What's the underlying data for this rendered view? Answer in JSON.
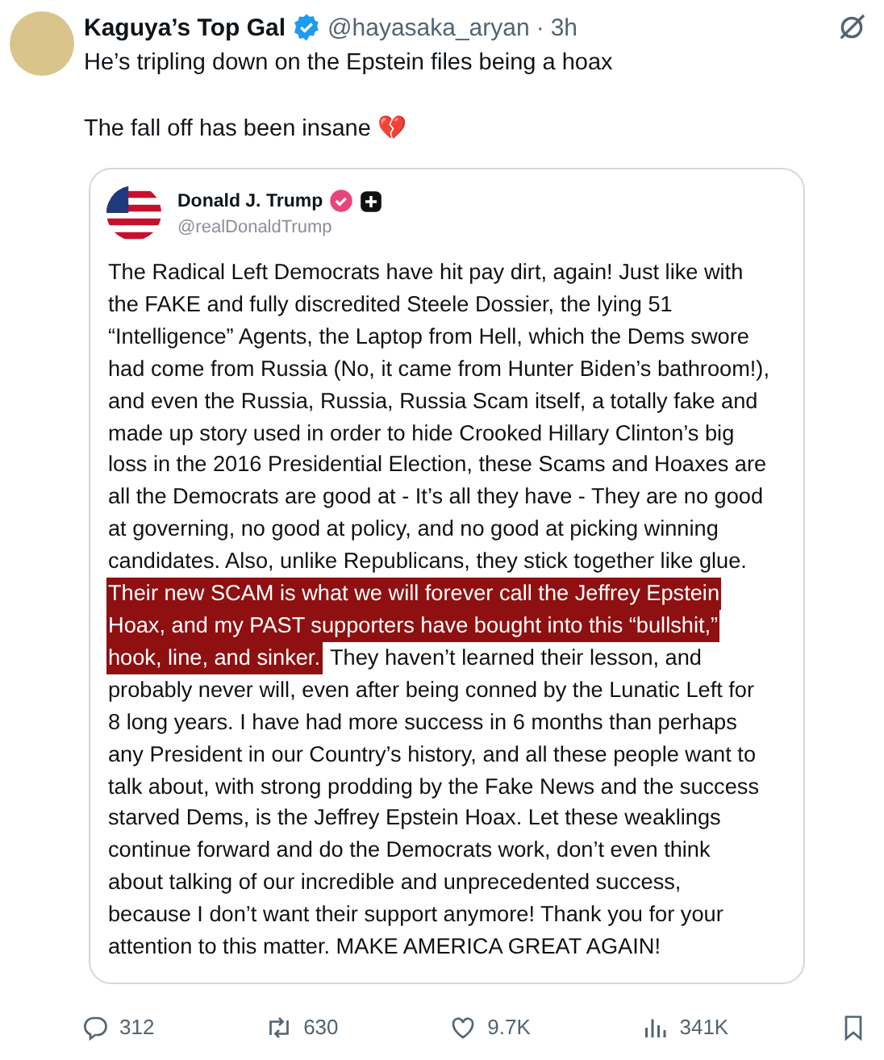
{
  "author": {
    "name": "Kaguya’s Top Gal",
    "verified": true,
    "handle": "@hayasaka_aryan",
    "separator": "·",
    "time": "3h"
  },
  "text": [
    "He’s tripling down on the Epstein files being a hoax",
    "The fall off has been insane 💔"
  ],
  "quoted_post": {
    "name": "Donald J. Trump",
    "verified": true,
    "handle": "@realDonaldTrump",
    "lines": [
      [
        {
          "text": "The Radical Left Democrats have hit pay dirt, again! Just like with",
          "highlighted": false
        }
      ],
      [
        {
          "text": "the FAKE and fully discredited Steele Dossier, the lying 51",
          "highlighted": false
        }
      ],
      [
        {
          "text": "“Intelligence” Agents, the Laptop from Hell, which the Dems swore",
          "highlighted": false
        }
      ],
      [
        {
          "text": "had come from Russia (No, it came from Hunter Biden’s bathroom!),",
          "highlighted": false
        }
      ],
      [
        {
          "text": "and even the Russia, Russia, Russia Scam itself, a totally fake and",
          "highlighted": false
        }
      ],
      [
        {
          "text": "made up story used in order to hide Crooked Hillary Clinton’s big",
          "highlighted": false
        }
      ],
      [
        {
          "text": "loss in the 2016 Presidential Election, these Scams and Hoaxes are",
          "highlighted": false
        }
      ],
      [
        {
          "text": "all the Democrats are good at - It’s all they have - They are no good",
          "highlighted": false
        }
      ],
      [
        {
          "text": "at governing, no good at policy, and no good at picking winning",
          "highlighted": false
        }
      ],
      [
        {
          "text": "candidates. Also, unlike Republicans, they stick together like glue.",
          "highlighted": false
        }
      ],
      [
        {
          "text": "Their new SCAM is what we will forever call the Jeffrey Epstein",
          "highlighted": true
        }
      ],
      [
        {
          "text": "Hoax, and my PAST supporters have bought into this “bullshit,”",
          "highlighted": true
        }
      ],
      [
        {
          "text": "hook, line, and sinker.",
          "highlighted": true
        },
        {
          "text": "They haven’t learned their lesson, and",
          "highlighted": false
        }
      ],
      [
        {
          "text": "probably never will, even after being conned by the Lunatic Left for",
          "highlighted": false
        }
      ],
      [
        {
          "text": "8 long years. I have had more success in 6 months than perhaps",
          "highlighted": false
        }
      ],
      [
        {
          "text": "any President in our Country’s history, and all these people want to",
          "highlighted": false
        }
      ],
      [
        {
          "text": "talk about, with strong prodding by the Fake News and the success",
          "highlighted": false
        }
      ],
      [
        {
          "text": "starved Dems, is the Jeffrey Epstein Hoax. Let these weaklings",
          "highlighted": false
        }
      ],
      [
        {
          "text": "continue forward and do the Democrats work, don’t even think",
          "highlighted": false
        }
      ],
      [
        {
          "text": "about talking of our incredible and unprecedented success,",
          "highlighted": false
        }
      ],
      [
        {
          "text": "because I don’t want their support anymore! Thank you for your",
          "highlighted": false
        }
      ],
      [
        {
          "text": "attention to this matter. MAKE AMERICA GREAT AGAIN!",
          "highlighted": false
        }
      ]
    ]
  },
  "actions": [
    {
      "kind": "reply",
      "count": "312"
    },
    {
      "kind": "repost",
      "count": "630"
    },
    {
      "kind": "like",
      "count": "9.7K"
    },
    {
      "kind": "views",
      "count": "341K"
    },
    {
      "kind": "bookmark"
    }
  ]
}
